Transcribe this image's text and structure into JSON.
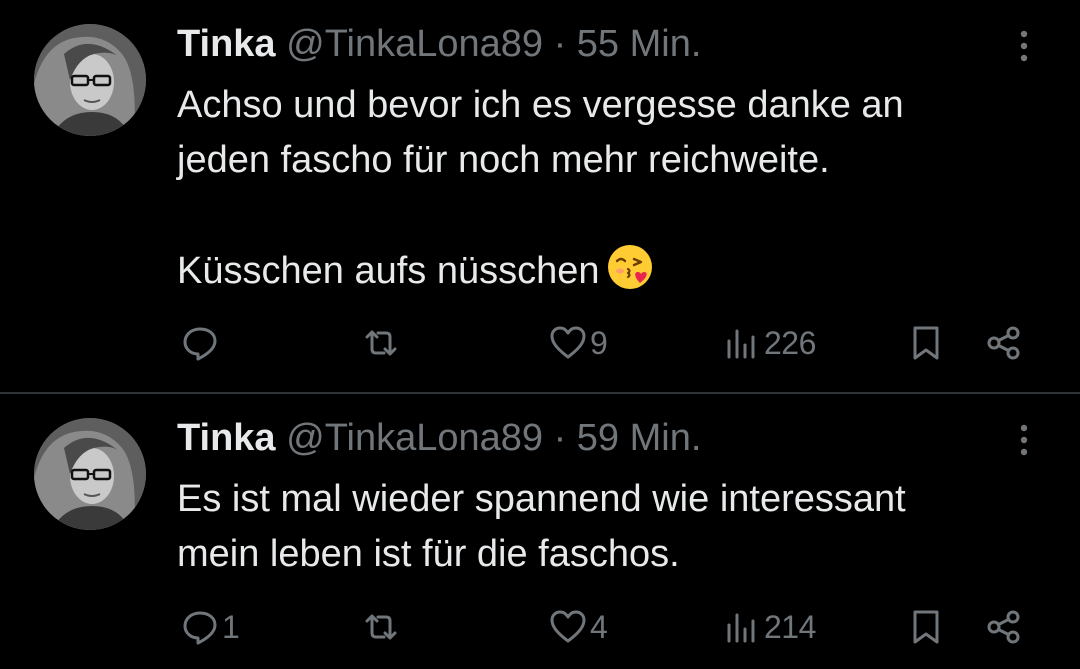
{
  "colors": {
    "background": "#000000",
    "text": "#e7e9ea",
    "muted": "#71767b",
    "divider": "#2f3336"
  },
  "tweets": [
    {
      "author": {
        "name": "Tinka",
        "handle": "@TinkaLona89",
        "separator": "·",
        "time": "55 Min.",
        "avatar_icon": "user-avatar-photo"
      },
      "text": "Achso und bevor ich es vergesse danke an\njeden fascho für noch mehr reichweite.\n\nKüsschen aufs nüsschen",
      "emoji": "face-blowing-a-kiss",
      "actions": {
        "reply": {
          "icon": "reply-icon",
          "count": ""
        },
        "retweet": {
          "icon": "retweet-icon",
          "count": ""
        },
        "like": {
          "icon": "heart-icon",
          "count": "9"
        },
        "views": {
          "icon": "views-chart-icon",
          "count": "226"
        },
        "bookmark": {
          "icon": "bookmark-icon"
        },
        "share": {
          "icon": "share-icon"
        }
      }
    },
    {
      "author": {
        "name": "Tinka",
        "handle": "@TinkaLona89",
        "separator": "·",
        "time": "59 Min.",
        "avatar_icon": "user-avatar-photo"
      },
      "text": "Es ist mal wieder spannend wie interessant\nmein leben ist für die faschos.",
      "actions": {
        "reply": {
          "icon": "reply-icon",
          "count": "1"
        },
        "retweet": {
          "icon": "retweet-icon",
          "count": ""
        },
        "like": {
          "icon": "heart-icon",
          "count": "4"
        },
        "views": {
          "icon": "views-chart-icon",
          "count": "214"
        },
        "bookmark": {
          "icon": "bookmark-icon"
        },
        "share": {
          "icon": "share-icon"
        }
      }
    }
  ]
}
